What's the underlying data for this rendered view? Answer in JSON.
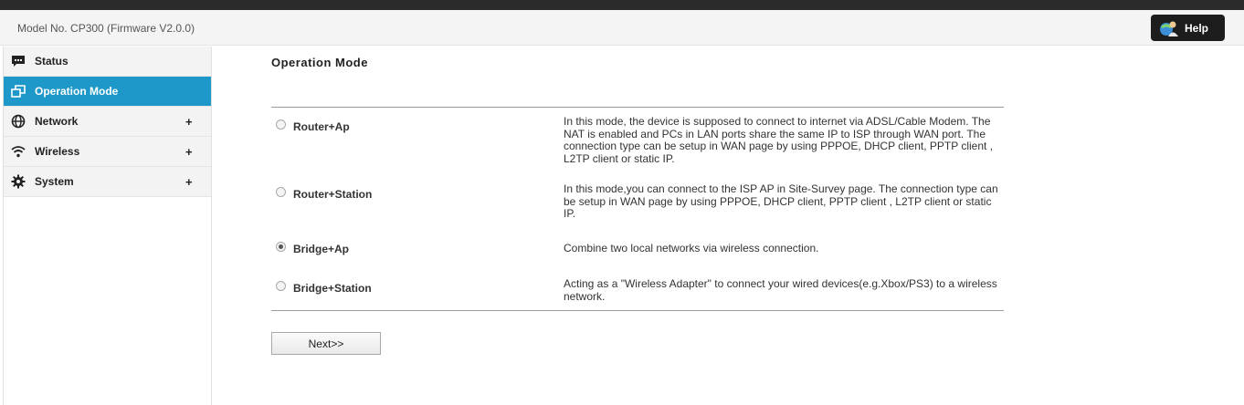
{
  "header": {
    "model": "Model No. CP300 (Firmware V2.0.0)",
    "help_label": "Help"
  },
  "sidebar": {
    "items": [
      {
        "label": "Status",
        "icon": "chat-bubble-icon",
        "expandable": false,
        "active": false
      },
      {
        "label": "Operation Mode",
        "icon": "windows-icon",
        "expandable": false,
        "active": true
      },
      {
        "label": "Network",
        "icon": "globe-icon",
        "expandable": true,
        "active": false
      },
      {
        "label": "Wireless",
        "icon": "wifi-icon",
        "expandable": true,
        "active": false
      },
      {
        "label": "System",
        "icon": "gear-icon",
        "expandable": true,
        "active": false
      }
    ],
    "expand_symbol": "+"
  },
  "main": {
    "title": "Operation Mode",
    "options": [
      {
        "label": "Router+Ap",
        "checked": false,
        "description": "In this mode, the device is supposed to connect to internet via ADSL/Cable Modem. The NAT is enabled and PCs in LAN ports share the same IP to ISP through WAN port. The connection type can be setup in WAN page by using PPPOE, DHCP client, PPTP client , L2TP client or static IP."
      },
      {
        "label": "Router+Station",
        "checked": false,
        "description": "In this mode,you can connect to the ISP AP in Site-Survey page. The connection type can be setup in WAN page by using PPPOE, DHCP client, PPTP client , L2TP client or static IP."
      },
      {
        "label": "Bridge+Ap",
        "checked": true,
        "description": "Combine two local networks via wireless connection."
      },
      {
        "label": "Bridge+Station",
        "checked": false,
        "description": "Acting as a \"Wireless Adapter\" to connect your wired devices(e.g.Xbox/PS3) to a wireless network."
      }
    ],
    "next_label": "Next>>"
  },
  "colors": {
    "active_nav": "#1e98c8",
    "top_bar": "#2b2b2b",
    "help_button": "#1d1d1d"
  }
}
